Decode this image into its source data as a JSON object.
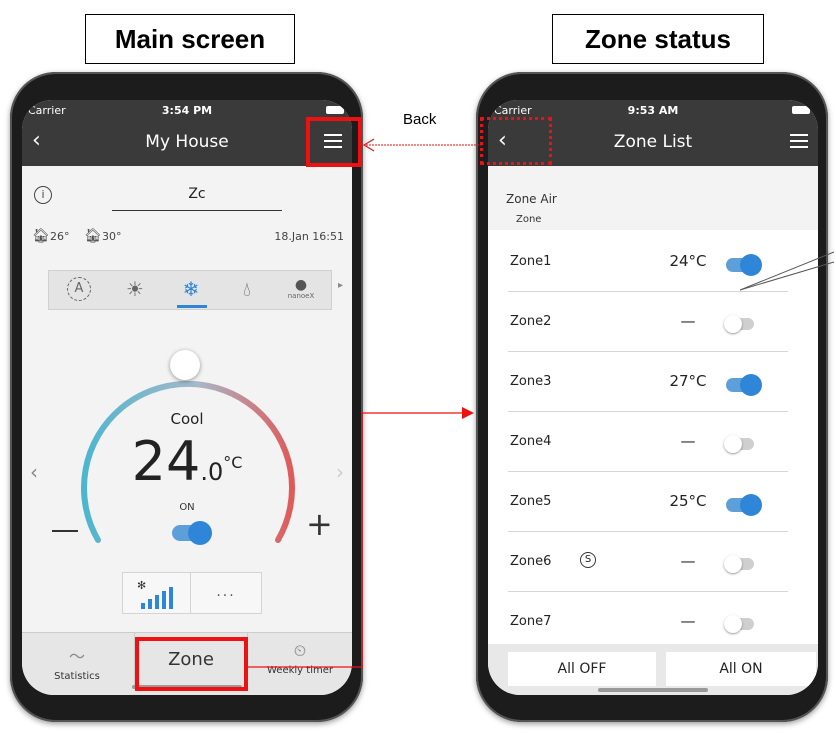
{
  "captions": {
    "main": "Main screen",
    "zone": "Zone status"
  },
  "annotation": {
    "back": "Back"
  },
  "main_screen": {
    "status": {
      "carrier": "Carrier",
      "time": "3:54 PM"
    },
    "nav": {
      "title": "My House"
    },
    "device_name": "Zc",
    "indoor_temp": "26°",
    "outdoor_temp": "30°",
    "datetime": "18.Jan 16:51",
    "mode_label": "Cool",
    "temp_value": "24",
    "temp_decimal": ".0",
    "temp_unit": "°C",
    "power_label": "ON",
    "nanoe_label": "nanoeX",
    "more_label": "...",
    "tabs": {
      "statistics": "Statistics",
      "zone": "Zone",
      "weekly_timer": "Weekly timer"
    },
    "colors": {
      "accent": "#2f86d8",
      "arc_cool": "#4db6cf",
      "arc_warm": "#e05a5a"
    }
  },
  "zone_screen": {
    "status": {
      "carrier": "Carrier",
      "time": "9:53 AM"
    },
    "nav": {
      "title": "Zone List"
    },
    "section_title": "Zone Air",
    "column_header": "Zone",
    "zones": [
      {
        "name": "Zone1",
        "temp": "24°C"
      },
      {
        "name": "Zone2",
        "temp": "—"
      },
      {
        "name": "Zone3",
        "temp": "27°C"
      },
      {
        "name": "Zone4",
        "temp": "—"
      },
      {
        "name": "Zone5",
        "temp": "25°C"
      },
      {
        "name": "Zone6",
        "temp": "—"
      },
      {
        "name": "Zone7",
        "temp": "—"
      }
    ],
    "all_off_label": "All OFF",
    "all_on_label": "All ON"
  }
}
